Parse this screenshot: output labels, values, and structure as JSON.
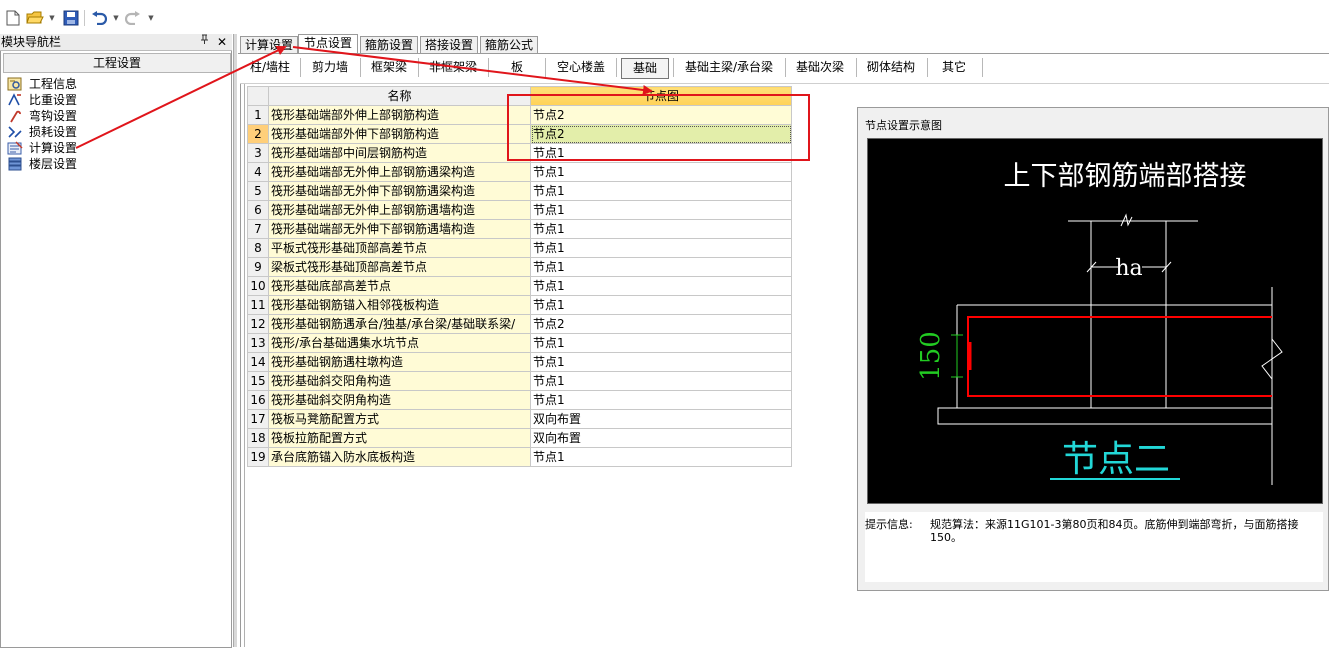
{
  "toolbar": {
    "icons": [
      "new-file-icon",
      "open-folder-icon",
      "save-icon",
      "undo-icon",
      "redo-icon"
    ]
  },
  "nav": {
    "title": "模块导航栏",
    "pin": "ᚹ",
    "close": "✕",
    "header": "工程设置",
    "items": [
      {
        "label": "工程信息",
        "icon": "project-info-icon"
      },
      {
        "label": "比重设置",
        "icon": "density-icon"
      },
      {
        "label": "弯钩设置",
        "icon": "hook-icon"
      },
      {
        "label": "损耗设置",
        "icon": "loss-icon"
      },
      {
        "label": "计算设置",
        "icon": "calc-settings-icon"
      },
      {
        "label": "楼层设置",
        "icon": "floor-settings-icon"
      }
    ]
  },
  "tabs": [
    "计算设置",
    "节点设置",
    "箍筋设置",
    "搭接设置",
    "箍筋公式"
  ],
  "active_tab": "节点设置",
  "subtabs": [
    "柱/墙柱",
    "剪力墙",
    "框架梁",
    "非框架梁",
    "板",
    "空心楼盖",
    "基础",
    "基础主梁/承台梁",
    "基础次梁",
    "砌体结构",
    "其它"
  ],
  "active_subtab": "基础",
  "grid": {
    "col_name": "名称",
    "col_node": "节点图",
    "rows": [
      {
        "no": "1",
        "name": "筏形基础端部外伸上部钢筋构造",
        "node": "节点2"
      },
      {
        "no": "2",
        "name": "筏形基础端部外伸下部钢筋构造",
        "node": "节点2"
      },
      {
        "no": "3",
        "name": "筏形基础端部中间层钢筋构造",
        "node": "节点1"
      },
      {
        "no": "4",
        "name": "筏形基础端部无外伸上部钢筋遇梁构造",
        "node": "节点1"
      },
      {
        "no": "5",
        "name": "筏形基础端部无外伸下部钢筋遇梁构造",
        "node": "节点1"
      },
      {
        "no": "6",
        "name": "筏形基础端部无外伸上部钢筋遇墙构造",
        "node": "节点1"
      },
      {
        "no": "7",
        "name": "筏形基础端部无外伸下部钢筋遇墙构造",
        "node": "节点1"
      },
      {
        "no": "8",
        "name": "平板式筏形基础顶部高差节点",
        "node": "节点1"
      },
      {
        "no": "9",
        "name": "梁板式筏形基础顶部高差节点",
        "node": "节点1"
      },
      {
        "no": "10",
        "name": "筏形基础底部高差节点",
        "node": "节点1"
      },
      {
        "no": "11",
        "name": "筏形基础钢筋锚入相邻筏板构造",
        "node": "节点1"
      },
      {
        "no": "12",
        "name": "筏形基础钢筋遇承台/独基/承台梁/基础联系梁/",
        "node": "节点2"
      },
      {
        "no": "13",
        "name": "筏形/承台基础遇集水坑节点",
        "node": "节点1"
      },
      {
        "no": "14",
        "name": "筏形基础钢筋遇柱墩构造",
        "node": "节点1"
      },
      {
        "no": "15",
        "name": "筏形基础斜交阳角构造",
        "node": "节点1"
      },
      {
        "no": "16",
        "name": "筏形基础斜交阴角构造",
        "node": "节点1"
      },
      {
        "no": "17",
        "name": "筏板马凳筋配置方式",
        "node": "双向布置"
      },
      {
        "no": "18",
        "name": "筏板拉筋配置方式",
        "node": "双向布置"
      },
      {
        "no": "19",
        "name": "承台底筋锚入防水底板构造",
        "node": "节点1"
      }
    ],
    "selected_row": "2"
  },
  "diagram": {
    "panel_title": "节点设置示意图",
    "heading": "上下部钢筋端部搭接",
    "dim_ha": "ha",
    "dim_150": "150",
    "caption": "节点二",
    "hint_label": "提示信息:",
    "hint_text": "规范算法：来源11G101-3第80页和84页。底筋伸到端部弯折，与面筋搭接150。"
  },
  "colors": {
    "annotation": "#e0151b",
    "diagram_bg": "#000000",
    "rebar": "#ff0000",
    "dim_green": "#22cc22",
    "caption_cyan": "#22d7d7"
  }
}
